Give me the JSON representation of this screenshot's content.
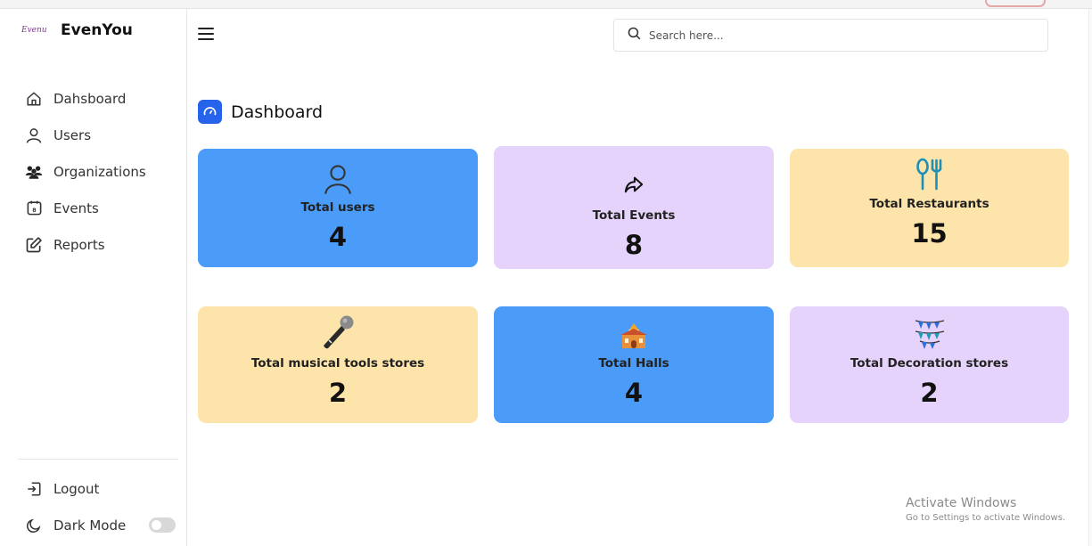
{
  "brand": {
    "logo_text": "Evenu",
    "name": "EvenYou"
  },
  "sidebar": {
    "items": [
      {
        "label": "Dahsboard",
        "icon": "home-icon"
      },
      {
        "label": "Users",
        "icon": "user-icon"
      },
      {
        "label": "Organizations",
        "icon": "group-icon"
      },
      {
        "label": "Events",
        "icon": "calendar-icon"
      },
      {
        "label": "Reports",
        "icon": "edit-icon"
      }
    ],
    "bottom": [
      {
        "label": "Logout",
        "icon": "logout-icon"
      },
      {
        "label": "Dark Mode",
        "icon": "moon-icon"
      }
    ],
    "dark_mode_enabled": false
  },
  "header": {
    "search_placeholder": "Search here..."
  },
  "page": {
    "title": "Dashboard"
  },
  "cards": [
    {
      "label": "Total users",
      "value": "4",
      "color": "#4b9cf9",
      "icon": "user-outline-icon"
    },
    {
      "label": "Total Events",
      "value": "8",
      "color": "#e5d3fb",
      "icon": "share-arrow-icon"
    },
    {
      "label": "Total Restaurants",
      "value": "15",
      "color": "#fde4aa",
      "icon": "utensils-icon"
    },
    {
      "label": "Total musical tools stores",
      "value": "2",
      "color": "#fde4aa",
      "icon": "microphone-icon"
    },
    {
      "label": "Total Halls",
      "value": "4",
      "color": "#4b9cf9",
      "icon": "hall-icon"
    },
    {
      "label": "Total Decoration stores",
      "value": "2",
      "color": "#e5d3fb",
      "icon": "bunting-icon"
    }
  ],
  "watermark": {
    "line1": "Activate Windows",
    "line2": "Go to Settings to activate Windows."
  },
  "colors": {
    "accent": "#2563eb",
    "blue_card": "#4b9cf9",
    "purple_card": "#e5d3fb",
    "yellow_card": "#fde4aa"
  }
}
